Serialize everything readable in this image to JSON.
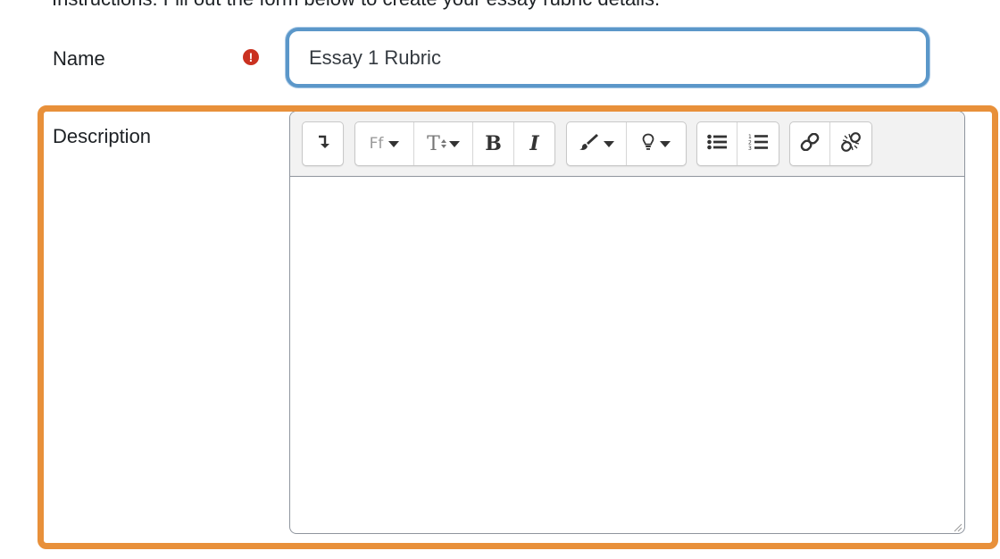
{
  "header": {
    "cut_text": "Instructions: Fill out the form below to create your essay rubric details."
  },
  "form": {
    "name": {
      "label": "Name",
      "required_icon": "exclamation-circle-icon",
      "required_glyph": "!",
      "value": "Essay 1 Rubric"
    },
    "description": {
      "label": "Description",
      "content": ""
    }
  },
  "toolbar": {
    "show_more": {
      "icon": "show-more-icon",
      "glyph": "↴"
    },
    "font_family": {
      "label": "Ff",
      "icon": "font-family-icon"
    },
    "font_size": {
      "label": "T",
      "icon": "font-size-icon"
    },
    "bold": {
      "label": "B",
      "icon": "bold-icon"
    },
    "italic": {
      "label": "I",
      "icon": "italic-icon"
    },
    "font_color": {
      "icon": "paintbrush-icon"
    },
    "background_color": {
      "icon": "lightbulb-icon"
    },
    "unordered_list": {
      "icon": "unordered-list-icon"
    },
    "ordered_list": {
      "icon": "ordered-list-icon"
    },
    "link": {
      "icon": "link-icon"
    },
    "unlink": {
      "icon": "unlink-icon"
    }
  },
  "colors": {
    "focus_border": "#5b97c9",
    "highlight_border": "#e8903a",
    "required_icon": "#ca3120",
    "toolbar_bg": "#f2f2f2"
  }
}
